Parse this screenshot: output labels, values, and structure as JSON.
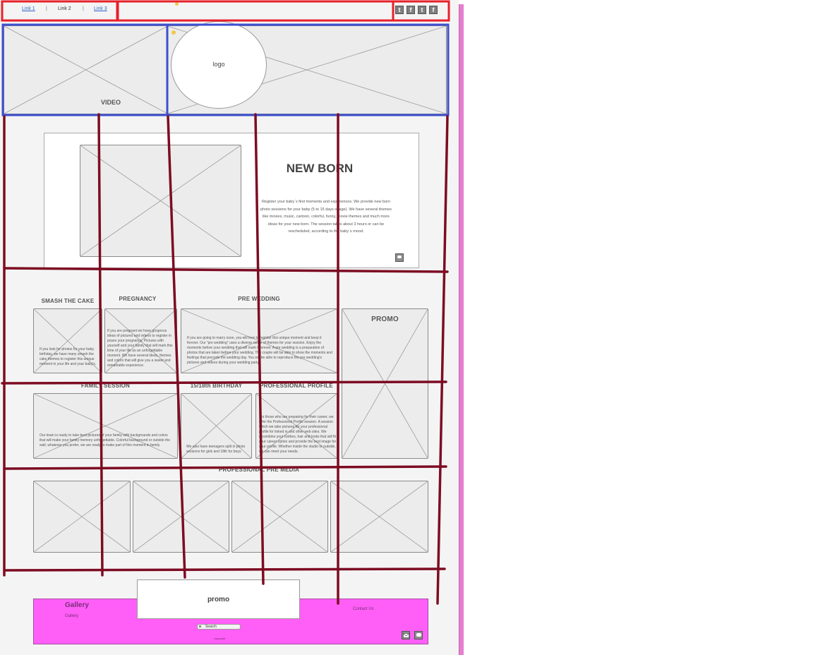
{
  "nav": {
    "links": [
      "Link 1",
      "Link 2",
      "Link 3"
    ],
    "separator": "|",
    "social_icons": [
      "twitter-icon",
      "facebook-icon",
      "twitter-icon",
      "facebook-icon"
    ]
  },
  "hero": {
    "video_label": "VIDEO",
    "logo_label": "logo"
  },
  "newborn": {
    "title": "NEW BORN",
    "body": "Register your baby´s first moments and experiences. We provide new born photo sessions for your baby (5 to 15 days of age). We have several themes like movies, music, cartoon, colorful, funny, movie themes and much more ideas for your new born. The session takes about 3 hours or can be rescheduled, according to the baby´s mood.",
    "icon": "chat-bubble-icon"
  },
  "services_row1": [
    {
      "title": "SMASH THE CAKE",
      "text": "If you look for photos for your baby birthday, we have many smash the cake themes to register this unique moment in your life and your baby's."
    },
    {
      "title": "PREGNANCY",
      "text": "If you are pregnant we have gorgeous ideas of pictures and videos to register in poses your pregnancy. Pictures with yourself and your family that will mark this time of your life as an unforgettable moment. We have several ideas, themes and colors that will give you a sweet and remarkable experience."
    },
    {
      "title": "PRE WEDDING",
      "text": "If you are going to marry soon, you will love to register this unique moment and keep it forever. Our \"pre wedding\" uses a diverse range of themes for your session. Enjoy the moments before your wedding that will mark it forever. A pre wedding is a preparation of photos that are taken before your wedding. The couple will be able to show the moments and feelings that precede the wedding day. You will be able to reproduce the pre wedding's pictures and videos during your wedding party."
    }
  ],
  "promo_side": {
    "title": "PROMO"
  },
  "services_row2": [
    {
      "title": "FAMILY SESSION",
      "text": "Our team is ready to take best pictures of your family with backgrounds and colors that will make your family memory unforgettable. Colorful background or outside the wall, whatever you prefer, we are ready to make part of this moment in family."
    },
    {
      "title": "15/18th BIRTHDAY",
      "text": "We also have teenagers split in photo sessions for girls and 18th for boys."
    },
    {
      "title": "PROFESSIONAL PROFILE",
      "text": "For those who are preparing for their career, we offer the Professional Profile session. A session which we take pictures for your professional profile for linked in and other web sites. We recombine your clothes, hair and looks that will fit your career option and provide the best image for your profile. Whether inside the studio or outside, we can meet your needs."
    }
  ],
  "media_heading": "PROFESSIONAL PRE MEDIA",
  "footer": {
    "gallery_title": "Gallery",
    "gallery_link": "Gallery",
    "promo_label": "promo",
    "search_value": "Search",
    "contact_label": "Contact Us",
    "copyright": "copyright",
    "icons": [
      "mail-icon",
      "chat-bubble-icon"
    ]
  },
  "colors": {
    "nav_outline": "#e8202a",
    "hero_outline": "#3d4fcf",
    "grid_lines": "#7d0c22",
    "footer_bg": "#ff5ff7",
    "page_bg": "#f4f4f4",
    "link": "#2b63c9",
    "side_bar": "#e57fd0"
  }
}
